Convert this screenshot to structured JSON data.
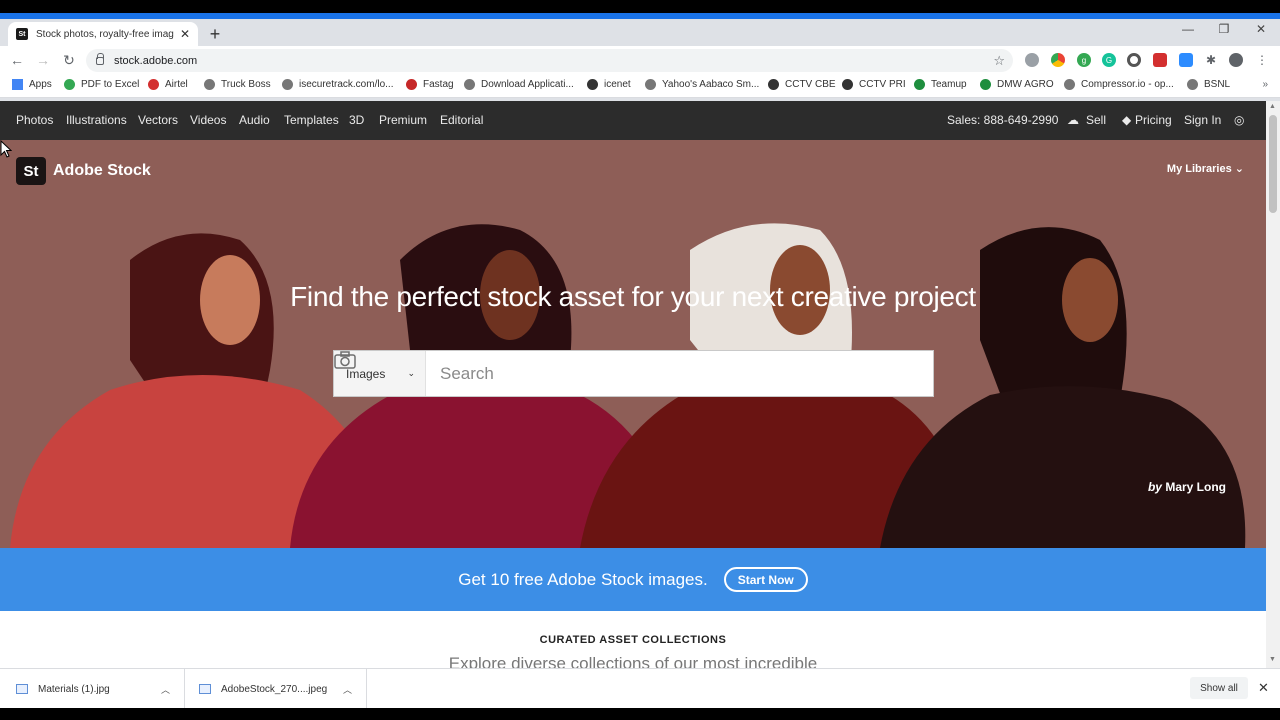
{
  "browser": {
    "tab_title": "Stock photos, royalty-free image",
    "tab_favicon": "St",
    "url": "stock.adobe.com",
    "bookmarks": [
      "Apps",
      "PDF to Excel",
      "Airtel",
      "Truck Boss",
      "isecuretrack.com/lo...",
      "Fastag",
      "Download Applicati...",
      "icenet",
      "Yahoo's Aabaco Sm...",
      "CCTV CBE",
      "CCTV PRI",
      "Teamup",
      "DMW AGRO",
      "Compressor.io - op...",
      "BSNL"
    ],
    "bookmarks_more": "»"
  },
  "site_nav": {
    "items": [
      "Photos",
      "Illustrations",
      "Vectors",
      "Videos",
      "Audio",
      "Templates",
      "3D",
      "Premium",
      "Editorial"
    ],
    "sales": "Sales: 888-649-2990",
    "sell": "Sell",
    "pricing": "Pricing",
    "sign_in": "Sign In"
  },
  "hero": {
    "brand_mark": "St",
    "brand_name": "Adobe Stock",
    "my_libraries": "My Libraries",
    "headline": "Find the perfect stock asset for your next creative project",
    "search_type": "Images",
    "search_placeholder": "Search",
    "credit_by": "by",
    "credit_name": "Mary Long"
  },
  "promo": {
    "text": "Get 10 free Adobe Stock images.",
    "button": "Start Now"
  },
  "curated": {
    "title": "CURATED ASSET COLLECTIONS",
    "subtitle": "Explore diverse collections of our most incredible"
  },
  "downloads": {
    "items": [
      "Materials (1).jpg",
      "AdobeStock_270....jpeg"
    ],
    "show_all": "Show all"
  },
  "colors": {
    "hero_bg": "#8e5e57",
    "promo_bg": "#3c8ee6",
    "nav_bg": "#2c2c2c"
  }
}
